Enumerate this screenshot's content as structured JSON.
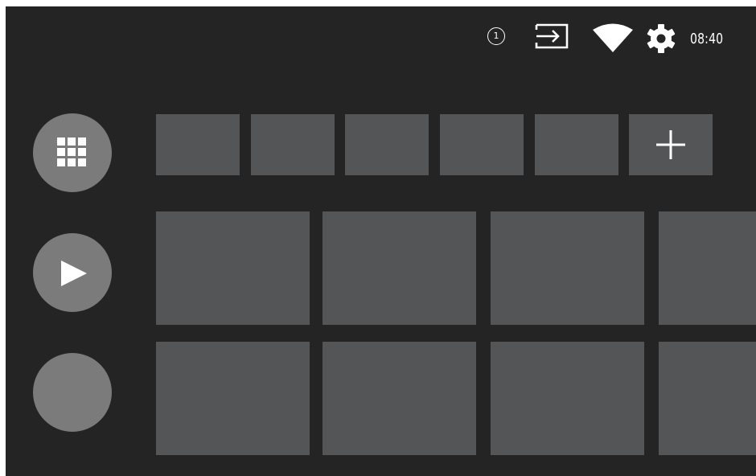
{
  "statusbar": {
    "notification_count": "1",
    "icons": [
      "input-source-icon",
      "wifi-icon",
      "settings-gear-icon"
    ],
    "clock": "08:40"
  },
  "sidebar": {
    "buttons": [
      {
        "name": "apps-button",
        "icon": "apps-grid-icon"
      },
      {
        "name": "play-button",
        "icon": "play-icon"
      },
      {
        "name": "blank-button",
        "icon": ""
      }
    ]
  },
  "favorites": {
    "tile_count": 5,
    "add_icon": "plus-icon"
  },
  "content_rows": {
    "row1_tile_count": 4,
    "row2_tile_count": 4
  },
  "colors": {
    "background": "#242424",
    "tile": "#545556",
    "round_button": "#7b7b7b",
    "foreground": "#ffffff"
  }
}
